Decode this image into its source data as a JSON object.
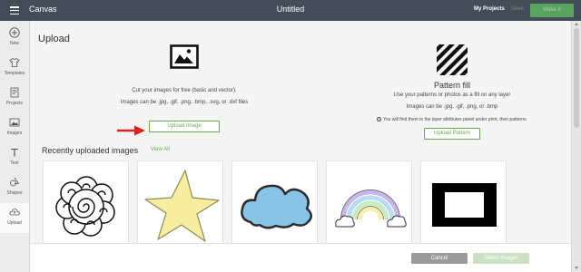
{
  "topbar": {
    "title": "Canvas",
    "project_name": "Untitled",
    "my_projects": "My Projects",
    "save": "Save",
    "make_it": "Make It"
  },
  "sidebar": {
    "items": [
      {
        "label": "New",
        "icon": "plus-icon"
      },
      {
        "label": "Templates",
        "icon": "shirt-icon"
      },
      {
        "label": "Projects",
        "icon": "projects-icon"
      },
      {
        "label": "Images",
        "icon": "image-icon"
      },
      {
        "label": "Text",
        "icon": "text-icon"
      },
      {
        "label": "Shapes",
        "icon": "shapes-icon"
      },
      {
        "label": "Upload",
        "icon": "upload-icon",
        "active": true
      }
    ]
  },
  "upload": {
    "heading": "Upload",
    "cut_text": "Cut your images for free (basic and vector).",
    "types_text": "Images can be .jpg, .gif, .png, .bmp, .svg, or .dxf files",
    "button": "Upload Image"
  },
  "pattern": {
    "title": "Pattern fill",
    "description": "Use your patterns or photos as a fill on any layer",
    "types_text": "Images can be .jpg, .gif, .png, or .bmp",
    "info": "You will find them in the layer attributes panel under print, then patterns.",
    "button": "Upload Pattern"
  },
  "recent": {
    "heading": "Recently uploaded images",
    "view_all": "View All",
    "images": [
      {
        "name": "mandala-flower"
      },
      {
        "name": "yellow-star"
      },
      {
        "name": "blue-cloud"
      },
      {
        "name": "rainbow"
      },
      {
        "name": "black-frame"
      }
    ]
  },
  "footer": {
    "cancel": "Cancel",
    "select_images": "Select Images"
  },
  "colors": {
    "topbar": "#434d57",
    "accent_green": "#6aa84f",
    "make_it_green": "#58a35e",
    "arrow_red": "#e02020"
  }
}
